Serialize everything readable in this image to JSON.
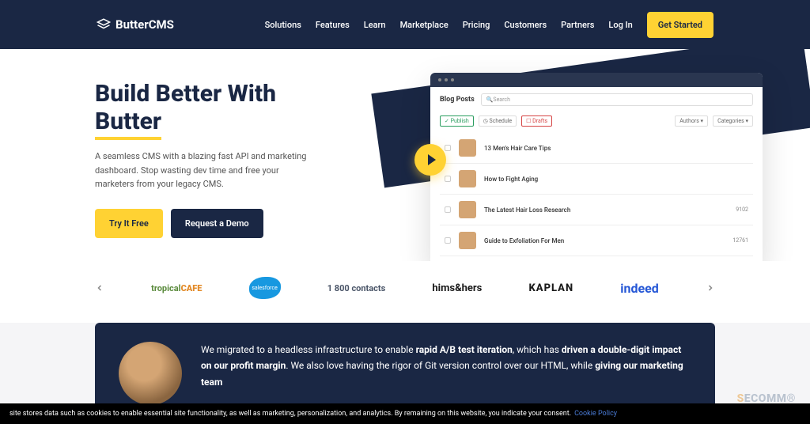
{
  "header": {
    "brand": "ButterCMS",
    "nav": [
      "Solutions",
      "Features",
      "Learn",
      "Marketplace",
      "Pricing",
      "Customers",
      "Partners",
      "Log In"
    ],
    "cta": "Get Started"
  },
  "hero": {
    "title_line1": "Build Better With",
    "title_line2": "Butter",
    "desc": "A seamless CMS with a blazing fast API and marketing dashboard. Stop wasting dev time and free your marketers from your legacy CMS.",
    "btn_primary": "Try It Free",
    "btn_secondary": "Request a Demo"
  },
  "dashboard": {
    "title": "Blog Posts",
    "search_placeholder": "Search",
    "filters": {
      "published": "✓ Publish",
      "scheduled": "◷ Schedule",
      "draft": "☐ Drafts",
      "authors": "Authors ▾",
      "categories": "Categories ▾"
    },
    "rows": [
      {
        "title": "13 Men's Hair Care Tips",
        "num": ""
      },
      {
        "title": "How to Fight Aging",
        "num": ""
      },
      {
        "title": "The Latest Hair Loss Research",
        "num": "9102"
      },
      {
        "title": "Guide to Exfoliation For Men",
        "num": "12761"
      }
    ]
  },
  "logos": {
    "cafe_t": "tropical",
    "cafe_c": "CAFE",
    "sf": "salesforce",
    "contacts": "1 800 contacts",
    "hh": "hims&hers",
    "kaplan": "KAPLAN",
    "indeed": "indeed"
  },
  "testimonial": {
    "text_parts": [
      "We migrated to a headless infrastructure to enable ",
      "rapid A/B test iteration",
      ", which has ",
      "driven a double-digit impact on our profit margin",
      ". We also love having the rigor of Git version control over our HTML, while ",
      "giving our marketing team"
    ]
  },
  "cookie": {
    "text": "site stores data such as cookies to enable essential site functionality, as well as marketing, personalization, and analytics. By remaining on this website, you indicate your consent.",
    "link": "Cookie Policy"
  },
  "watermark": {
    "s": "S",
    "rest": "ECOMM®"
  }
}
